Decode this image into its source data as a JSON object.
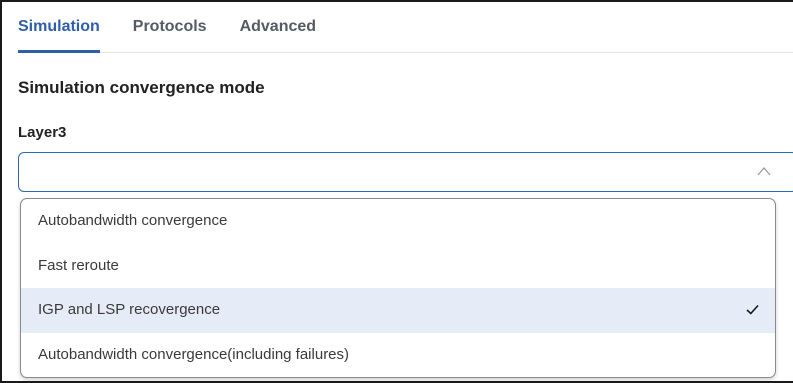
{
  "tabs": [
    {
      "label": "Simulation",
      "active": true
    },
    {
      "label": "Protocols",
      "active": false
    },
    {
      "label": "Advanced",
      "active": false
    }
  ],
  "section": {
    "title": "Simulation convergence mode"
  },
  "field": {
    "label": "Layer3",
    "value": ""
  },
  "dropdown": {
    "options": [
      {
        "label": "Autobandwidth convergence",
        "selected": false
      },
      {
        "label": "Fast reroute",
        "selected": false
      },
      {
        "label": "IGP and LSP recovergence",
        "selected": true
      },
      {
        "label": "Autobandwidth convergence(including failures)",
        "selected": false
      }
    ]
  },
  "colors": {
    "accent": "#2e5fa8",
    "selected_bg": "#e6ecf7"
  }
}
